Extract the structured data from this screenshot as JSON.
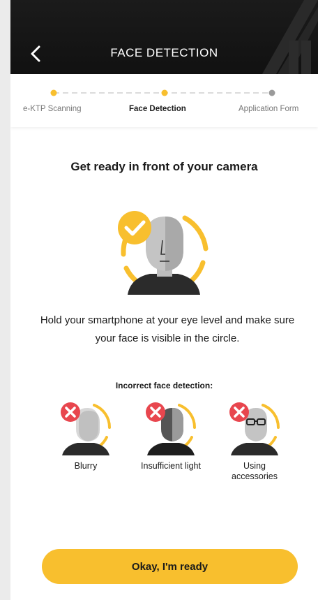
{
  "header": {
    "title": "FACE DETECTION"
  },
  "stepper": {
    "steps": [
      {
        "label": "e-KTP Scanning"
      },
      {
        "label": "Face Detection"
      },
      {
        "label": "Application Form"
      }
    ]
  },
  "main": {
    "heading": "Get ready in front of your camera",
    "instruction": "Hold your smartphone at your eye level and make sure your face is visible in the circle.",
    "incorrect_title": "Incorrect face detection:",
    "examples": [
      {
        "label": "Blurry"
      },
      {
        "label": "Insufficient light"
      },
      {
        "label": "Using accessories"
      }
    ]
  },
  "cta": {
    "label": "Okay, I'm ready"
  },
  "colors": {
    "accent": "#f8bf2e",
    "header_bg": "#151515",
    "error": "#e8464e"
  }
}
